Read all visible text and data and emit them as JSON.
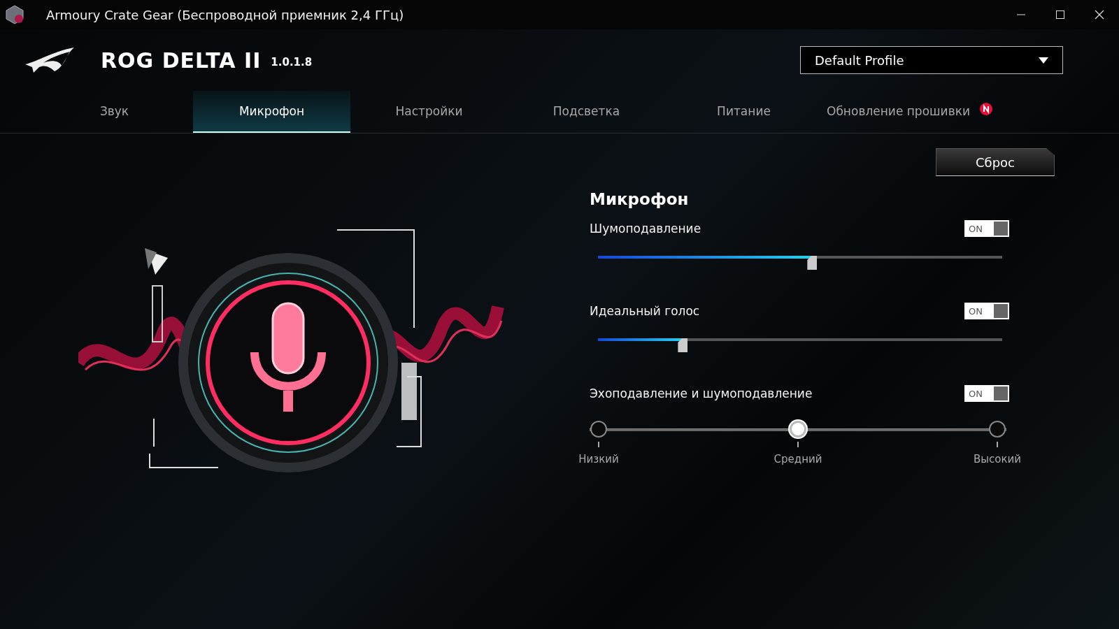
{
  "window": {
    "title": "Armoury Crate Gear (Беспроводной приемник 2,4 ГГц)"
  },
  "header": {
    "product": "ROG DELTA II",
    "version": "1.0.1.8",
    "profile": {
      "value": "Default Profile"
    }
  },
  "tabs": [
    {
      "label": "Звук",
      "selected": false,
      "badge": false
    },
    {
      "label": "Микрофон",
      "selected": true,
      "badge": false
    },
    {
      "label": "Настройки",
      "selected": false,
      "badge": false
    },
    {
      "label": "Подсветка",
      "selected": false,
      "badge": false
    },
    {
      "label": "Питание",
      "selected": false,
      "badge": false
    },
    {
      "label": "Обновление прошивки",
      "selected": false,
      "badge": true
    }
  ],
  "panel": {
    "reset_button": "Сброс",
    "heading": "Микрофон",
    "settings": [
      {
        "kind": "slider",
        "label": "Шумоподавление",
        "toggle": {
          "label": "ON",
          "on": true
        },
        "level": 0.53
      },
      {
        "kind": "slider",
        "label": "Идеальный голос",
        "toggle": {
          "label": "ON",
          "on": true
        },
        "level": 0.21
      },
      {
        "kind": "steps",
        "label": "Эхоподавление и шумоподавление",
        "toggle": {
          "label": "ON",
          "on": true
        },
        "steps": [
          {
            "label": "Низкий",
            "selected": false
          },
          {
            "label": "Средний",
            "selected": true
          },
          {
            "label": "Высокий",
            "selected": false
          }
        ]
      }
    ]
  }
}
